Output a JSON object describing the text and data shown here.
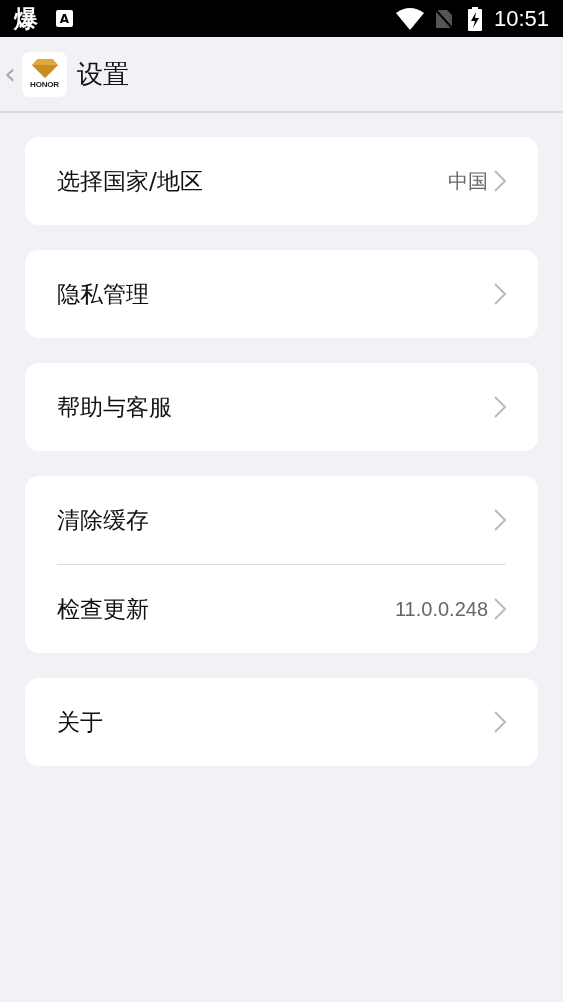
{
  "status_bar": {
    "notification_glyph": "爆",
    "keyboard_glyph": "A",
    "time": "10:51"
  },
  "header": {
    "back_glyph": "‹",
    "logo_text": "HONOR",
    "title": "设置"
  },
  "groups": [
    {
      "items": [
        {
          "label": "选择国家/地区",
          "value": "中国"
        }
      ]
    },
    {
      "items": [
        {
          "label": "隐私管理"
        }
      ]
    },
    {
      "items": [
        {
          "label": "帮助与客服"
        }
      ]
    },
    {
      "items": [
        {
          "label": "清除缓存"
        },
        {
          "label": "检查更新",
          "value": "11.0.0.248"
        }
      ]
    },
    {
      "items": [
        {
          "label": "关于"
        }
      ]
    }
  ]
}
